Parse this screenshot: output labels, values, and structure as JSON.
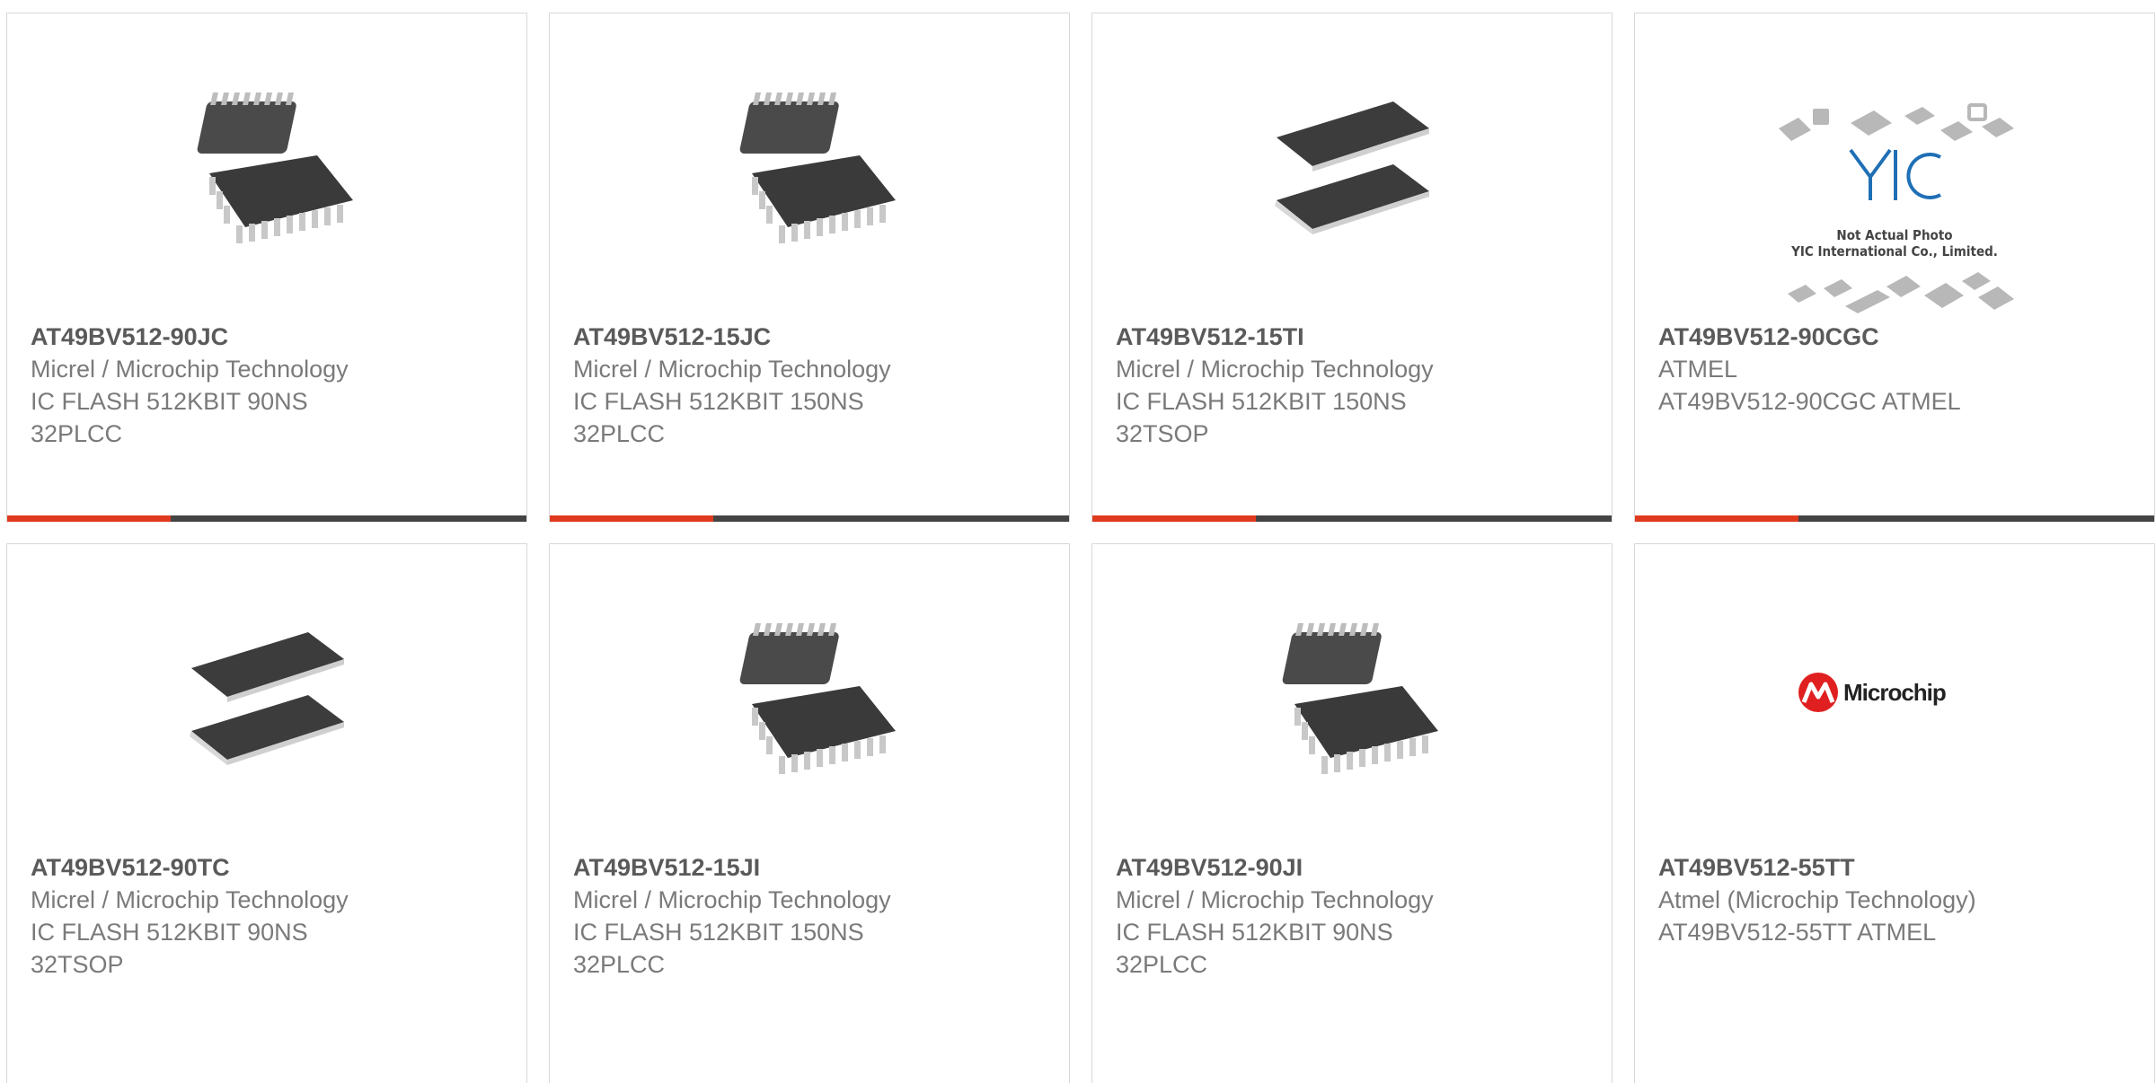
{
  "products": [
    {
      "part": "AT49BV512-90JC",
      "manufacturer": "Micrel / Microchip Technology",
      "description": "IC FLASH 512KBIT 90NS",
      "package": "32PLCC",
      "image": "plcc-chip-icon"
    },
    {
      "part": "AT49BV512-15JC",
      "manufacturer": "Micrel / Microchip Technology",
      "description": "IC FLASH 512KBIT 150NS",
      "package": "32PLCC",
      "image": "plcc-chip-icon"
    },
    {
      "part": "AT49BV512-15TI",
      "manufacturer": "Micrel / Microchip Technology",
      "description": "IC FLASH 512KBIT 150NS",
      "package": "32TSOP",
      "image": "tsop-chip-icon"
    },
    {
      "part": "AT49BV512-90CGC",
      "manufacturer": "ATMEL",
      "description": "AT49BV512-90CGC ATMEL",
      "package": "",
      "image": "yic-placeholder-icon",
      "image_text": [
        "Not Actual Photo",
        "YIC International Co., Limited."
      ]
    },
    {
      "part": "AT49BV512-90TC",
      "manufacturer": "Micrel / Microchip Technology",
      "description": "IC FLASH 512KBIT 90NS",
      "package": "32TSOP",
      "image": "tsop-chip-icon"
    },
    {
      "part": "AT49BV512-15JI",
      "manufacturer": "Micrel / Microchip Technology",
      "description": "IC FLASH 512KBIT 150NS",
      "package": "32PLCC",
      "image": "plcc-chip-icon"
    },
    {
      "part": "AT49BV512-90JI",
      "manufacturer": "Micrel / Microchip Technology",
      "description": "IC FLASH 512KBIT 90NS",
      "package": "32PLCC",
      "image": "plcc-chip-icon"
    },
    {
      "part": "AT49BV512-55TT",
      "manufacturer": "Atmel (Microchip Technology)",
      "description": "AT49BV512-55TT ATMEL",
      "package": "",
      "image": "microchip-logo-icon",
      "image_text": [
        "Microchip"
      ]
    }
  ],
  "colors": {
    "accent": "#e03a1e",
    "bar": "#444444",
    "title_text": "#5a5a5a",
    "body_text": "#7a7a7a",
    "card_border": "#d8d8d8"
  }
}
